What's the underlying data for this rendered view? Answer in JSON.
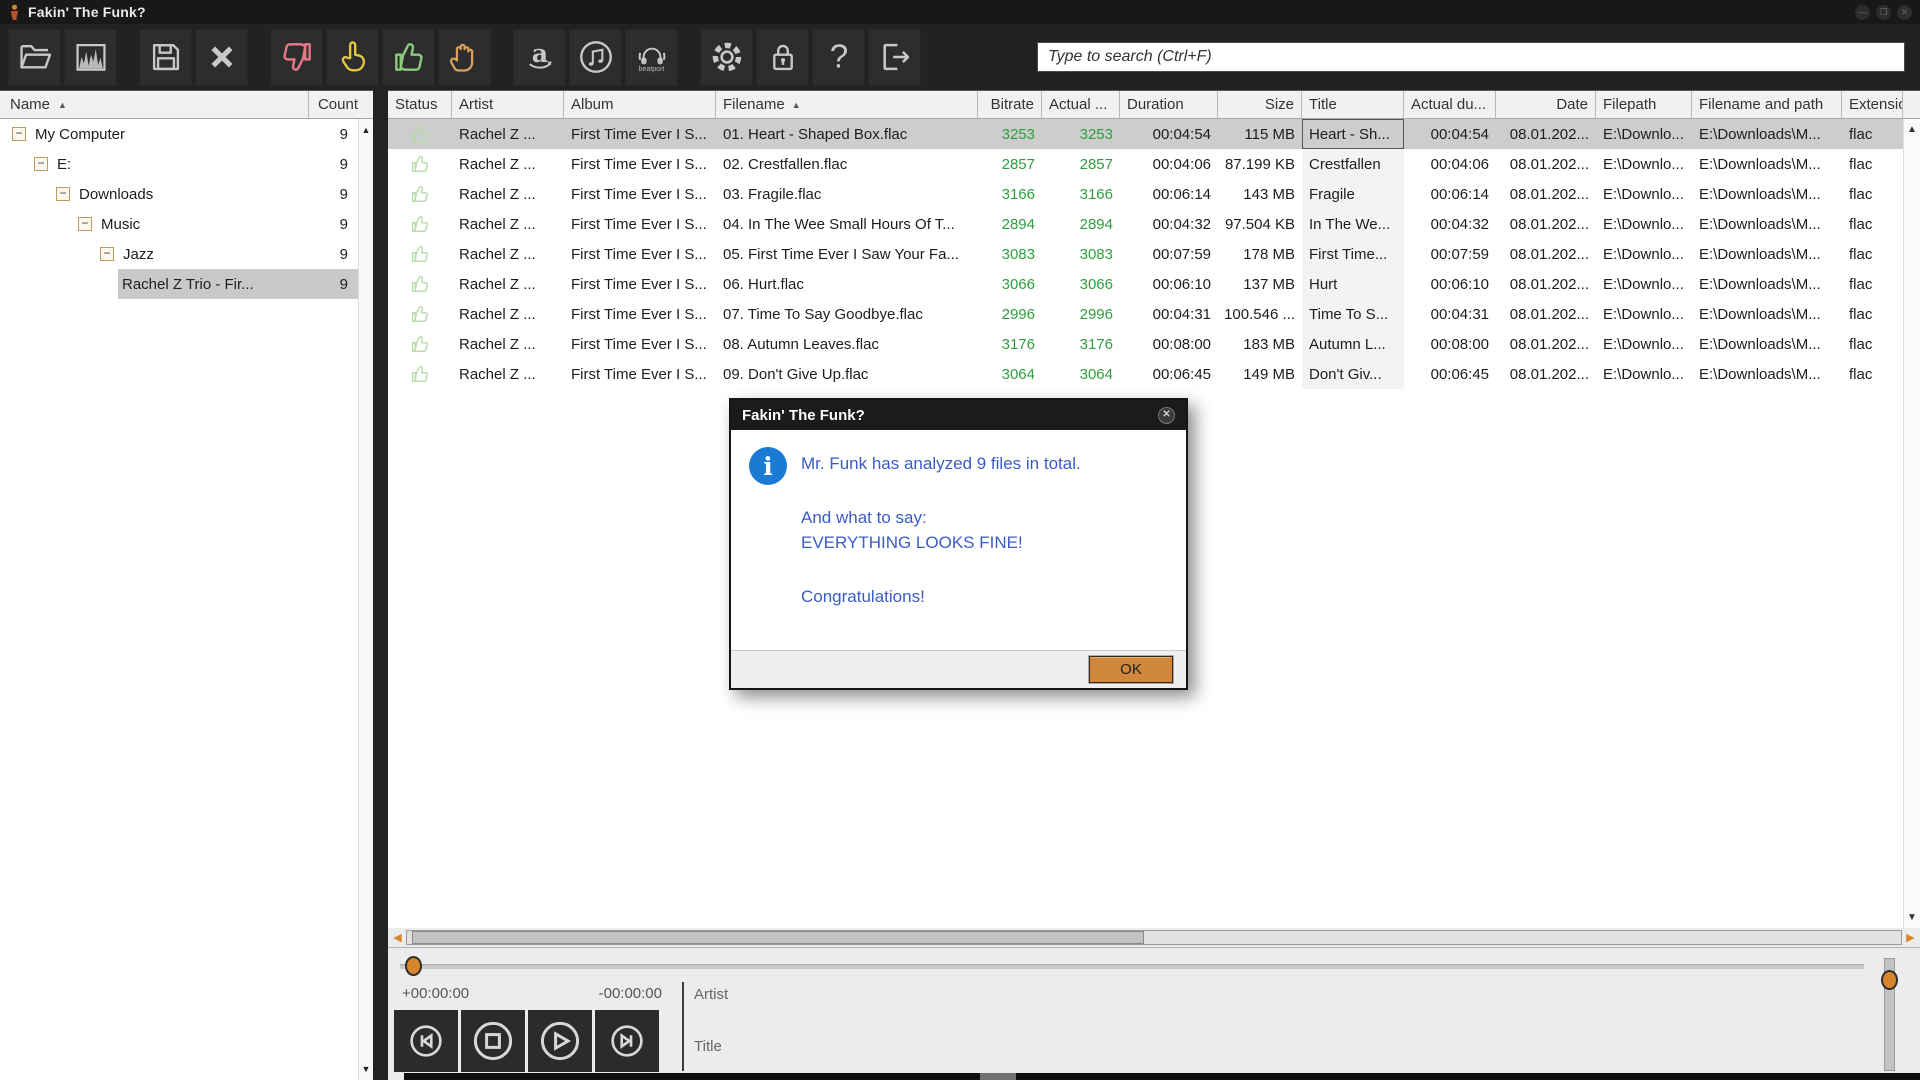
{
  "window": {
    "title": "Fakin' The Funk?",
    "controls": {
      "minimize": "—",
      "maximize": "❐",
      "close": "✕"
    }
  },
  "toolbar": {
    "search": {
      "placeholder": "Type to search (Ctrl+F)"
    },
    "beatport_label": "beatport"
  },
  "tree": {
    "header": {
      "name": "Name",
      "count": "Count",
      "sort_arrow": "▲"
    },
    "items": [
      {
        "label": "My Computer",
        "count": "9",
        "depth": 0,
        "expander": true,
        "selected": false
      },
      {
        "label": "E:",
        "count": "9",
        "depth": 1,
        "expander": true,
        "selected": false
      },
      {
        "label": "Downloads",
        "count": "9",
        "depth": 2,
        "expander": true,
        "selected": false
      },
      {
        "label": "Music",
        "count": "9",
        "depth": 3,
        "expander": true,
        "selected": false
      },
      {
        "label": "Jazz",
        "count": "9",
        "depth": 4,
        "expander": true,
        "selected": false
      },
      {
        "label": "Rachel Z Trio - Fir...",
        "count": "9",
        "depth": 5,
        "expander": false,
        "selected": true
      }
    ]
  },
  "table": {
    "columns": [
      {
        "key": "status",
        "label": "Status"
      },
      {
        "key": "artist",
        "label": "Artist"
      },
      {
        "key": "album",
        "label": "Album"
      },
      {
        "key": "filename",
        "label": "Filename",
        "sorted": true
      },
      {
        "key": "bitrate",
        "label": "Bitrate"
      },
      {
        "key": "actual_bitrate",
        "label": "Actual ..."
      },
      {
        "key": "duration",
        "label": "Duration"
      },
      {
        "key": "size",
        "label": "Size"
      },
      {
        "key": "title",
        "label": "Title"
      },
      {
        "key": "actual_duration",
        "label": "Actual du..."
      },
      {
        "key": "date",
        "label": "Date"
      },
      {
        "key": "filepath",
        "label": "Filepath"
      },
      {
        "key": "filename_and_path",
        "label": "Filename and path"
      },
      {
        "key": "extension",
        "label": "Extensio..."
      }
    ],
    "rows": [
      {
        "status": "thumbs-up",
        "artist": "Rachel Z ...",
        "album": "First Time Ever I S...",
        "filename": "01. Heart - Shaped Box.flac",
        "bitrate": "3253",
        "actual_bitrate": "3253",
        "duration": "00:04:54",
        "size": "115 MB",
        "title": "Heart - Sh...",
        "actual_duration": "00:04:54",
        "date": "08.01.202...",
        "filepath": "E:\\Downlo...",
        "filename_and_path": "E:\\Downloads\\M...",
        "extension": "flac",
        "selected": true
      },
      {
        "status": "thumbs-up",
        "artist": "Rachel Z ...",
        "album": "First Time Ever I S...",
        "filename": "02. Crestfallen.flac",
        "bitrate": "2857",
        "actual_bitrate": "2857",
        "duration": "00:04:06",
        "size": "87.199 KB",
        "title": "Crestfallen",
        "actual_duration": "00:04:06",
        "date": "08.01.202...",
        "filepath": "E:\\Downlo...",
        "filename_and_path": "E:\\Downloads\\M...",
        "extension": "flac",
        "selected": false
      },
      {
        "status": "thumbs-up",
        "artist": "Rachel Z ...",
        "album": "First Time Ever I S...",
        "filename": "03. Fragile.flac",
        "bitrate": "3166",
        "actual_bitrate": "3166",
        "duration": "00:06:14",
        "size": "143 MB",
        "title": "Fragile",
        "actual_duration": "00:06:14",
        "date": "08.01.202...",
        "filepath": "E:\\Downlo...",
        "filename_and_path": "E:\\Downloads\\M...",
        "extension": "flac",
        "selected": false
      },
      {
        "status": "thumbs-up",
        "artist": "Rachel Z ...",
        "album": "First Time Ever I S...",
        "filename": "04. In The Wee Small Hours Of T...",
        "bitrate": "2894",
        "actual_bitrate": "2894",
        "duration": "00:04:32",
        "size": "97.504 KB",
        "title": "In The We...",
        "actual_duration": "00:04:32",
        "date": "08.01.202...",
        "filepath": "E:\\Downlo...",
        "filename_and_path": "E:\\Downloads\\M...",
        "extension": "flac",
        "selected": false
      },
      {
        "status": "thumbs-up",
        "artist": "Rachel Z ...",
        "album": "First Time Ever I S...",
        "filename": "05. First Time Ever I Saw Your Fa...",
        "bitrate": "3083",
        "actual_bitrate": "3083",
        "duration": "00:07:59",
        "size": "178 MB",
        "title": "First Time...",
        "actual_duration": "00:07:59",
        "date": "08.01.202...",
        "filepath": "E:\\Downlo...",
        "filename_and_path": "E:\\Downloads\\M...",
        "extension": "flac",
        "selected": false
      },
      {
        "status": "thumbs-up",
        "artist": "Rachel Z ...",
        "album": "First Time Ever I S...",
        "filename": "06. Hurt.flac",
        "bitrate": "3066",
        "actual_bitrate": "3066",
        "duration": "00:06:10",
        "size": "137 MB",
        "title": "Hurt",
        "actual_duration": "00:06:10",
        "date": "08.01.202...",
        "filepath": "E:\\Downlo...",
        "filename_and_path": "E:\\Downloads\\M...",
        "extension": "flac",
        "selected": false
      },
      {
        "status": "thumbs-up",
        "artist": "Rachel Z ...",
        "album": "First Time Ever I S...",
        "filename": "07. Time To Say Goodbye.flac",
        "bitrate": "2996",
        "actual_bitrate": "2996",
        "duration": "00:04:31",
        "size": "100.546 ...",
        "title": "Time To S...",
        "actual_duration": "00:04:31",
        "date": "08.01.202...",
        "filepath": "E:\\Downlo...",
        "filename_and_path": "E:\\Downloads\\M...",
        "extension": "flac",
        "selected": false
      },
      {
        "status": "thumbs-up",
        "artist": "Rachel Z ...",
        "album": "First Time Ever I S...",
        "filename": "08. Autumn Leaves.flac",
        "bitrate": "3176",
        "actual_bitrate": "3176",
        "duration": "00:08:00",
        "size": "183 MB",
        "title": "Autumn L...",
        "actual_duration": "00:08:00",
        "date": "08.01.202...",
        "filepath": "E:\\Downlo...",
        "filename_and_path": "E:\\Downloads\\M...",
        "extension": "flac",
        "selected": false
      },
      {
        "status": "thumbs-up",
        "artist": "Rachel Z ...",
        "album": "First Time Ever I S...",
        "filename": "09. Don't Give Up.flac",
        "bitrate": "3064",
        "actual_bitrate": "3064",
        "duration": "00:06:45",
        "size": "149 MB",
        "title": "Don't Giv...",
        "actual_duration": "00:06:45",
        "date": "08.01.202...",
        "filepath": "E:\\Downlo...",
        "filename_and_path": "E:\\Downloads\\M...",
        "extension": "flac",
        "selected": false
      }
    ]
  },
  "dialog": {
    "title": "Fakin' The Funk?",
    "lines": [
      "Mr. Funk has analyzed 9 files in total.",
      "And what to say:",
      "EVERYTHING LOOKS FINE!",
      "Congratulations!"
    ],
    "ok_label": "OK",
    "close_glyph": "✕"
  },
  "player": {
    "elapsed": "+00:00:00",
    "remaining": "-00:00:00",
    "artist_label": "Artist",
    "title_label": "Title"
  },
  "colors": {
    "accent_orange": "#d8862c",
    "ok_button": "#d1883a",
    "good_green": "#2f9e3f",
    "dialog_blue": "#3a5cc5",
    "info_icon_blue": "#1b7ad4",
    "selected_row": "#cdcdcd"
  }
}
